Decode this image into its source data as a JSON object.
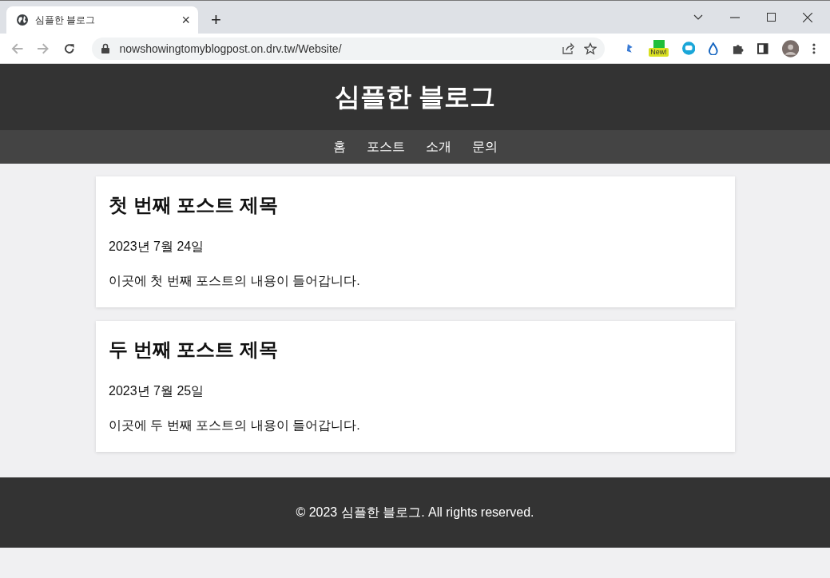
{
  "browser": {
    "tab_title": "심플한 블로그",
    "close_tab": "×",
    "new_tab": "+",
    "url": "nowshowingtomyblogpost.on.drv.tw/Website/",
    "extension_badge": "New!"
  },
  "site": {
    "title": "심플한 블로그",
    "nav": [
      "홈",
      "포스트",
      "소개",
      "문의"
    ],
    "posts": [
      {
        "title": "첫 번째 포스트 제목",
        "date": "2023년 7월 24일",
        "body": "이곳에 첫 번째 포스트의 내용이 들어갑니다."
      },
      {
        "title": "두 번째 포스트 제목",
        "date": "2023년 7월 25일",
        "body": "이곳에 두 번째 포스트의 내용이 들어갑니다."
      }
    ],
    "footer": "© 2023 심플한 블로그. All rights reserved."
  }
}
